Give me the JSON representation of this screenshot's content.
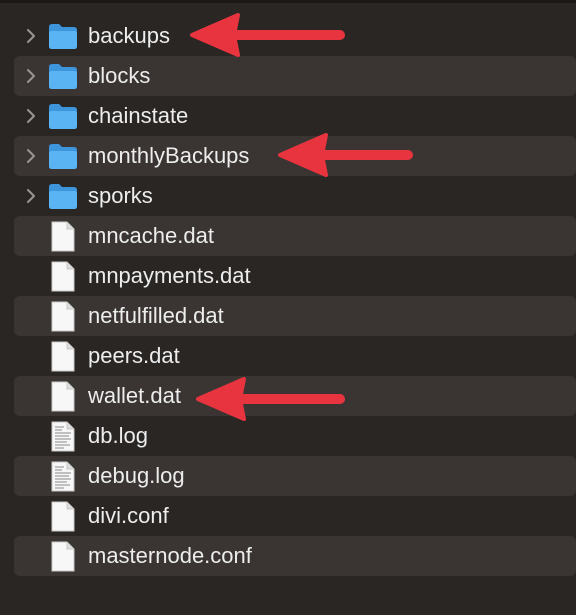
{
  "files": [
    {
      "name": "backups",
      "kind": "folder",
      "annotated": true
    },
    {
      "name": "blocks",
      "kind": "folder",
      "annotated": false
    },
    {
      "name": "chainstate",
      "kind": "folder",
      "annotated": false
    },
    {
      "name": "monthlyBackups",
      "kind": "folder",
      "annotated": true
    },
    {
      "name": "sporks",
      "kind": "folder",
      "annotated": false
    },
    {
      "name": "mncache.dat",
      "kind": "document",
      "annotated": false
    },
    {
      "name": "mnpayments.dat",
      "kind": "document",
      "annotated": false
    },
    {
      "name": "netfulfilled.dat",
      "kind": "document",
      "annotated": false
    },
    {
      "name": "peers.dat",
      "kind": "document",
      "annotated": false
    },
    {
      "name": "wallet.dat",
      "kind": "document",
      "annotated": true
    },
    {
      "name": "db.log",
      "kind": "text-document",
      "annotated": false
    },
    {
      "name": "debug.log",
      "kind": "text-document",
      "annotated": false
    },
    {
      "name": "divi.conf",
      "kind": "document",
      "annotated": false
    },
    {
      "name": "masternode.conf",
      "kind": "document",
      "annotated": false
    }
  ],
  "colors": {
    "background": "#2a2624",
    "alt_row": "#3a3533",
    "text": "#ededed",
    "folder": "#4aa8f0",
    "arrow": "#e8343f"
  }
}
